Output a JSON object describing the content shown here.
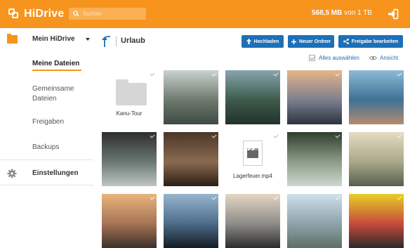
{
  "header": {
    "brand": "HiDrive",
    "search_placeholder": "Suchen",
    "quota_used": "568,5 MB",
    "quota_total": " von 1 TB"
  },
  "sidebar": {
    "section_title": "Mein HiDrive",
    "items": [
      {
        "label": "Meine Dateien",
        "active": true
      },
      {
        "label": "Gemeinsame Dateien",
        "active": false
      },
      {
        "label": "Freigaben",
        "active": false
      },
      {
        "label": "Backups",
        "active": false
      }
    ],
    "settings_label": "Einstellungen"
  },
  "toolbar": {
    "breadcrumb": "Urlaub",
    "upload_label": "Hochladen",
    "new_folder_label": "Neuer Ordner",
    "share_label": "Freigabe bearbeiten",
    "select_all_label": "Alles auswählen",
    "view_label": "Ansicht"
  },
  "files": [
    {
      "type": "folder",
      "name": "Kanu-Tour"
    },
    {
      "type": "photo",
      "name": "",
      "colors": [
        "#c9d3cf",
        "#6e7a6e",
        "#3f4a42"
      ]
    },
    {
      "type": "photo",
      "name": "",
      "colors": [
        "#87a5ad",
        "#3d5b4b",
        "#22322a"
      ]
    },
    {
      "type": "photo",
      "name": "",
      "colors": [
        "#e6b58a",
        "#7c7f8e",
        "#2d3340"
      ]
    },
    {
      "type": "photo",
      "name": "",
      "colors": [
        "#8dbad6",
        "#3f7196",
        "#b48c6f"
      ]
    },
    {
      "type": "photo",
      "name": "",
      "colors": [
        "#2d2d2d",
        "#6a7772",
        "#bfc6c3"
      ]
    },
    {
      "type": "photo",
      "name": "",
      "colors": [
        "#4a3629",
        "#8a6a51",
        "#2a1f17"
      ]
    },
    {
      "type": "video",
      "name": "Lagerfeuer.mp4"
    },
    {
      "type": "photo",
      "name": "",
      "colors": [
        "#2f3f2d",
        "#8d9c88",
        "#cdd8d0"
      ]
    },
    {
      "type": "photo",
      "name": "",
      "colors": [
        "#e5dbc1",
        "#a9a88a",
        "#555f4f"
      ]
    },
    {
      "type": "photo",
      "name": "",
      "colors": [
        "#e9b47b",
        "#a57456",
        "#3b2f2a"
      ]
    },
    {
      "type": "photo",
      "name": "",
      "colors": [
        "#96b5cf",
        "#4c6c88",
        "#141b22"
      ]
    },
    {
      "type": "photo",
      "name": "",
      "colors": [
        "#e4d7c3",
        "#8d8c88",
        "#2c2c2c"
      ]
    },
    {
      "type": "photo",
      "name": "",
      "colors": [
        "#cfe0ea",
        "#8ea3ac",
        "#5f6f64"
      ]
    },
    {
      "type": "photo",
      "name": "",
      "colors": [
        "#e7cf27",
        "#c74a3b",
        "#2b2b2b"
      ]
    }
  ]
}
